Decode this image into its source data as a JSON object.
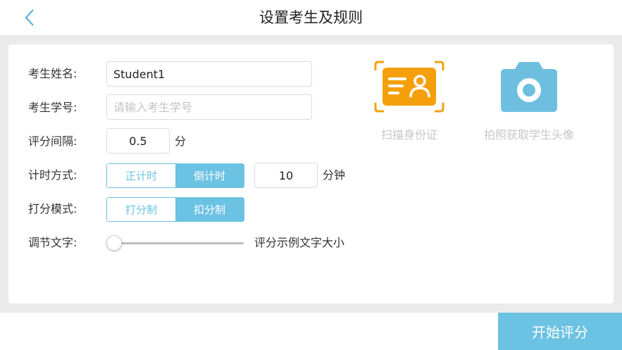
{
  "header": {
    "title": "设置考生及规则",
    "back_icon": "chevron-left-icon"
  },
  "form": {
    "name_label": "考生姓名:",
    "name_value": "Student1",
    "id_label": "考生学号:",
    "id_placeholder": "请输入考生学号",
    "interval_label": "评分间隔:",
    "interval_value": "0.5",
    "interval_unit": "分",
    "timing_label": "计时方式:",
    "timing_options": [
      "正计时",
      "倒计时"
    ],
    "timing_selected": "倒计时",
    "timing_value": "10",
    "timing_unit": "分钟",
    "mode_label": "打分模式:",
    "mode_options": [
      "打分制",
      "扣分制"
    ],
    "mode_selected": "扣分制",
    "font_label": "调节文字:",
    "font_sample": "评分示例文字大小",
    "font_slider_value": 0
  },
  "actions": {
    "scan_id_label": "扫描身份证",
    "scan_id_icon": "id-card-scan-icon",
    "photo_label": "拍照获取学生头像",
    "photo_icon": "camera-icon"
  },
  "footer": {
    "start_label": "开始评分"
  },
  "colors": {
    "accent": "#6cc2e2",
    "scan_orange": "#f5a00b",
    "camera_blue": "#6ebfdf",
    "muted_text": "#c6c6c6",
    "background": "#ebebeb"
  }
}
